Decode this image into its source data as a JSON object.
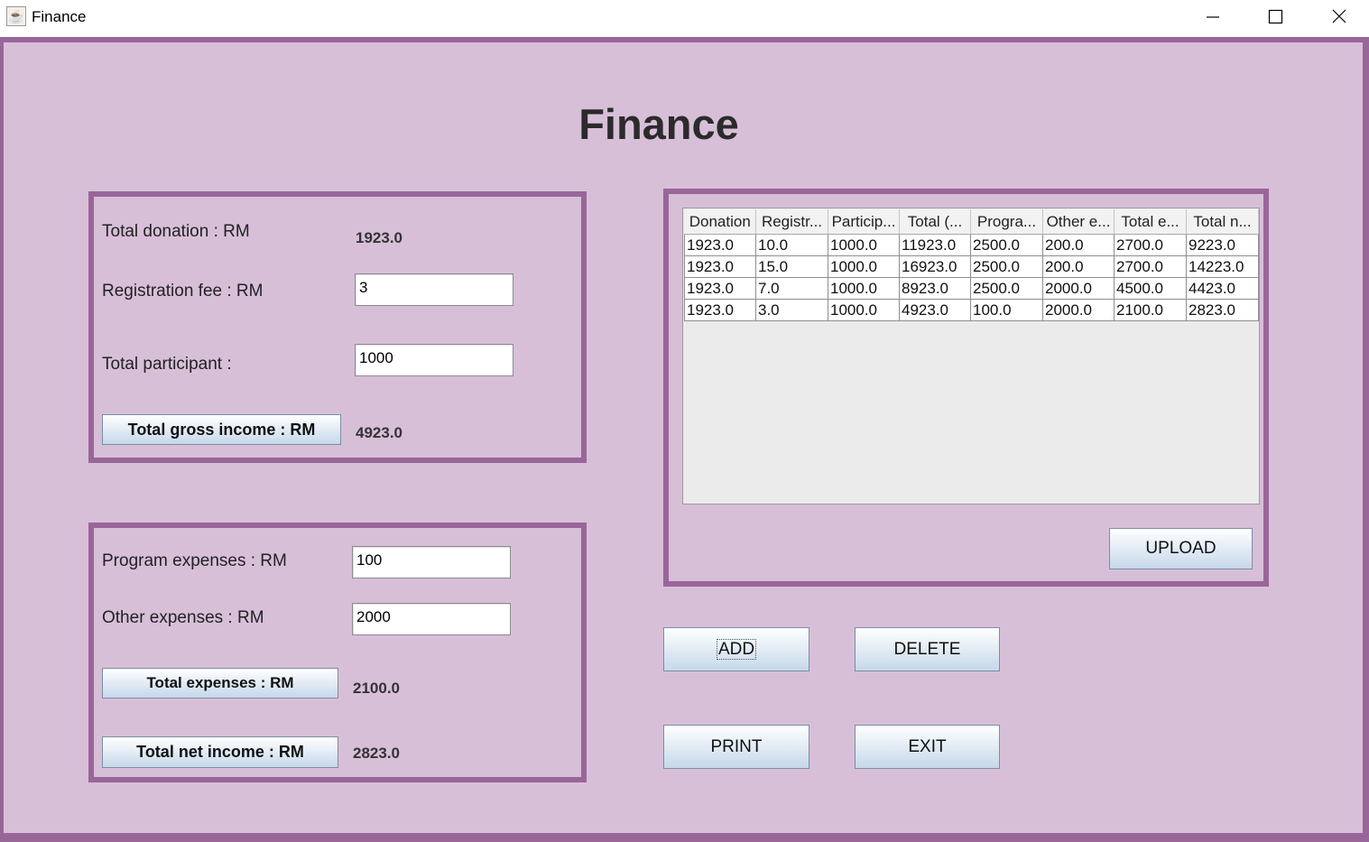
{
  "window": {
    "title": "Finance",
    "app_icon": "java-coffee-cup-icon",
    "controls": [
      "minimize-icon",
      "maximize-icon",
      "close-icon"
    ]
  },
  "heading": "Finance",
  "income": {
    "donation_label": "Total donation : RM",
    "donation_value": "1923.0",
    "reg_fee_label": "Registration fee : RM",
    "reg_fee_value": "3",
    "participant_label": "Total participant :",
    "participant_value": "1000",
    "gross_button": "Total gross income : RM",
    "gross_value": "4923.0"
  },
  "expenses": {
    "program_label": "Program expenses : RM",
    "program_value": "100",
    "other_label": "Other expenses : RM",
    "other_value": "2000",
    "total_exp_button": "Total expenses : RM",
    "total_exp_value": "2100.0",
    "net_button": "Total net income : RM",
    "net_value": "2823.0"
  },
  "table": {
    "columns": [
      "Donation",
      "Registr...",
      "Particip...",
      "Total (...",
      "Progra...",
      "Other e...",
      "Total e...",
      "Total n..."
    ],
    "rows": [
      [
        "1923.0",
        "10.0",
        "1000.0",
        "11923.0",
        "2500.0",
        "200.0",
        "2700.0",
        "9223.0"
      ],
      [
        "1923.0",
        "15.0",
        "1000.0",
        "16923.0",
        "2500.0",
        "200.0",
        "2700.0",
        "14223.0"
      ],
      [
        "1923.0",
        "7.0",
        "1000.0",
        "8923.0",
        "2500.0",
        "2000.0",
        "4500.0",
        "4423.0"
      ],
      [
        "1923.0",
        "3.0",
        "1000.0",
        "4923.0",
        "100.0",
        "2000.0",
        "2100.0",
        "2823.0"
      ]
    ]
  },
  "buttons": {
    "upload": "UPLOAD",
    "add": "ADD",
    "delete": "DELETE",
    "print": "PRINT",
    "exit": "EXIT"
  },
  "colors": {
    "background": "#d8bfd8",
    "border": "#996699"
  }
}
